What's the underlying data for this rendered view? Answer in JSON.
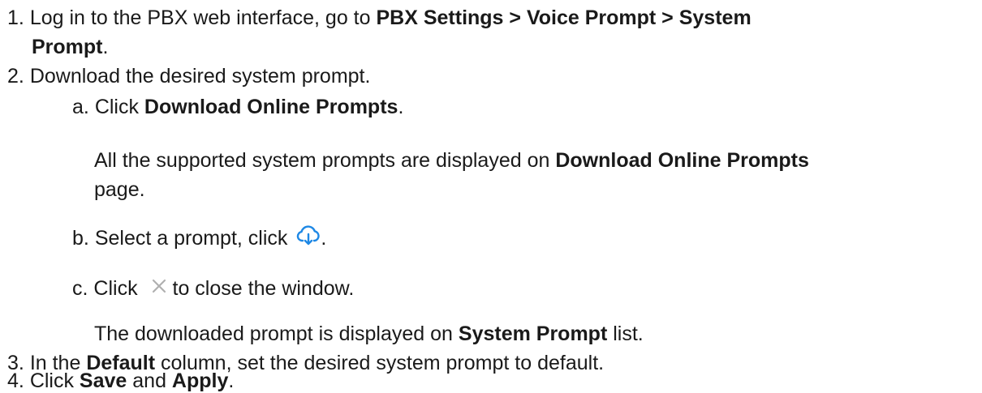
{
  "steps": [
    {
      "num": "1.",
      "text_a": "Log in to the PBX web interface, go to ",
      "bold_a": "PBX Settings > Voice Prompt > System",
      "bold_b": "Prompt",
      "end_b": "."
    },
    {
      "num": "2.",
      "text": "Download the desired system prompt.",
      "substeps": {
        "a": {
          "label": "a.",
          "pre": "Click ",
          "bold": "Download Online Prompts",
          "post": ".",
          "note_pre": "All the supported system prompts are displayed on ",
          "note_bold": "Download Online Prompts",
          "note_line2": "page."
        },
        "b": {
          "label": "b.",
          "pre": "Select a prompt, click ",
          "icon": "cloud-download-icon",
          "post": "."
        },
        "c": {
          "label": "c.",
          "pre": "Click ",
          "icon": "close-icon",
          "post": "to close the window.",
          "note_pre": "The downloaded prompt is displayed on ",
          "note_bold": "System Prompt",
          "note_post": " list."
        }
      }
    },
    {
      "num": "3.",
      "pre": "In the ",
      "bold": "Default",
      "post": " column, set the desired system prompt to default."
    },
    {
      "num": "4.",
      "pre": "Click ",
      "bold_a": "Save",
      "mid": " and ",
      "bold_b": "Apply",
      "post": "."
    }
  ],
  "colors": {
    "text": "#1a1a1a",
    "cloud_icon": "#1e88e5",
    "close_icon": "#b0b0b0"
  }
}
